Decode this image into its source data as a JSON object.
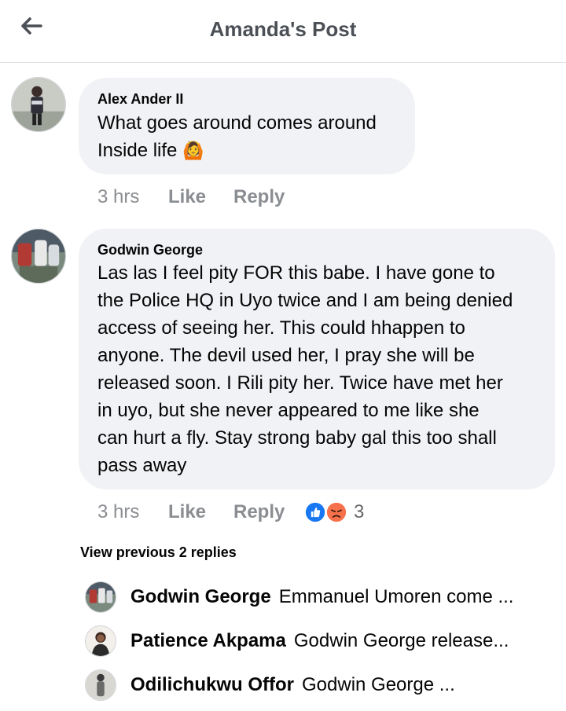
{
  "header": {
    "title": "Amanda's Post",
    "back_icon": "arrow-left-icon"
  },
  "comments": [
    {
      "author": "Alex Ander II",
      "text_lines": [
        "What goes around comes around",
        "Inside life"
      ],
      "emoji": "🙆",
      "time": "3 hrs",
      "like_label": "Like",
      "reply_label": "Reply"
    },
    {
      "author": "Godwin George",
      "text_lines": [
        "Las las I feel pity FOR this babe.  I have gone to",
        "the Police HQ in Uyo twice and I am being denied",
        "access of seeing her. This could hhappen to",
        "anyone. The devil used her, I pray she will be",
        "released soon. I Rili pity her. Twice have met her",
        "in uyo, but she never appeared to me like she",
        "can hurt a fly. Stay strong baby gal this too shall",
        "pass away"
      ],
      "time": "3 hrs",
      "like_label": "Like",
      "reply_label": "Reply",
      "reactions": {
        "icons": [
          "like-reaction-icon",
          "angry-reaction-icon"
        ],
        "count": "3",
        "colors": {
          "like": "#1877f2",
          "angry": "#f7714c"
        }
      }
    }
  ],
  "view_previous": "View previous 2 replies",
  "replies": [
    {
      "name": "Godwin George",
      "snippet": "Emmanuel Umoren come ..."
    },
    {
      "name": "Patience Akpama",
      "snippet": "Godwin George  release..."
    },
    {
      "name": "Odilichukwu Offor",
      "snippet": "Godwin George ..."
    }
  ],
  "colors": {
    "bubble": "#f0f2f5",
    "meta": "#8a8d91",
    "divider": "#dddfe2"
  }
}
